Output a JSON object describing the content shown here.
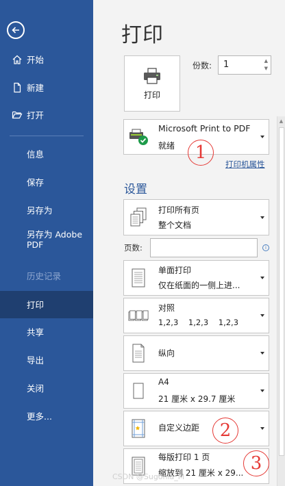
{
  "sidebar": {
    "items": [
      {
        "label": "开始"
      },
      {
        "label": "新建"
      },
      {
        "label": "打开"
      },
      {
        "label": "信息"
      },
      {
        "label": "保存"
      },
      {
        "label": "另存为"
      },
      {
        "label": "另存为 Adobe PDF"
      },
      {
        "label": "历史记录"
      },
      {
        "label": "打印"
      },
      {
        "label": "共享"
      },
      {
        "label": "导出"
      },
      {
        "label": "关闭"
      },
      {
        "label": "更多..."
      }
    ]
  },
  "main": {
    "title": "打印",
    "print_button_label": "打印",
    "copies_label": "份数:",
    "copies_value": "1",
    "printer": {
      "name": "Microsoft Print to PDF",
      "status": "就绪"
    },
    "printer_properties_link": "打印机属性",
    "settings_title": "设置",
    "pages_label": "页数:",
    "settings": [
      {
        "line1": "打印所有页",
        "line2": "整个文档"
      },
      {
        "line1": "单面打印",
        "line2": "仅在纸面的一侧上进..."
      },
      {
        "line1": "对照",
        "line2": "1,2,3    1,2,3    1,2,3"
      },
      {
        "line1": "纵向",
        "line2": ""
      },
      {
        "line1": "A4",
        "line2": "21 厘米 x 29.7 厘米"
      },
      {
        "line1": "自定义边距",
        "line2": ""
      },
      {
        "line1": "每版打印 1 页",
        "line2": "缩放到 21 厘米 x 29..."
      }
    ]
  },
  "annotations": [
    "1",
    "2",
    "3"
  ],
  "watermark": "CSDN @Sugonia_M",
  "colors": {
    "sidebar_bg": "#2b579a",
    "sidebar_active": "#1f3f70",
    "accent": "#2b579a",
    "annotation": "#e53935"
  }
}
